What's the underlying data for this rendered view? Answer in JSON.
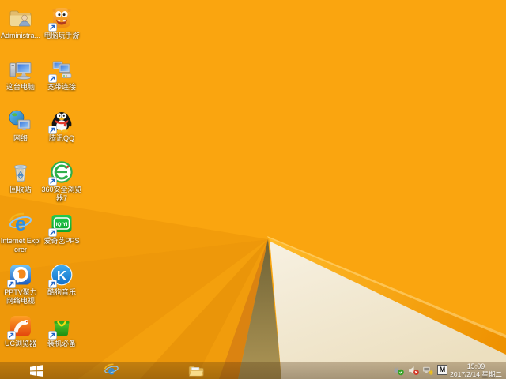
{
  "wallpaper": {
    "base_color": "#FAA50F",
    "cream_color": "#F2E8D2",
    "olive_color": "#9A874B",
    "fold_highlight_color": "#F5A000"
  },
  "desktop": {
    "icons": [
      {
        "label": "Administra...",
        "icon": "user-folder-icon",
        "shortcut": false
      },
      {
        "label": "这台电脑",
        "icon": "this-pc-icon",
        "shortcut": false
      },
      {
        "label": "网络",
        "icon": "network-icon",
        "shortcut": false
      },
      {
        "label": "回收站",
        "icon": "recycle-bin-icon",
        "shortcut": false
      },
      {
        "label": "Internet Explorer",
        "icon": "internet-explorer-icon",
        "shortcut": false
      },
      {
        "label": "PPTV聚力 网络电视",
        "icon": "pptv-icon",
        "shortcut": true
      },
      {
        "label": "UC浏览器",
        "icon": "uc-browser-icon",
        "shortcut": true
      },
      {
        "label": "电脑玩手游",
        "icon": "pc-mobile-game-icon",
        "shortcut": true
      },
      {
        "label": "宽带连接",
        "icon": "broadband-icon",
        "shortcut": true
      },
      {
        "label": "腾讯QQ",
        "icon": "qq-icon",
        "shortcut": true
      },
      {
        "label": "360安全浏览器7",
        "icon": "360-secure-browser-icon",
        "shortcut": true
      },
      {
        "label": "爱奇艺PPS",
        "icon": "iqiyi-pps-icon",
        "shortcut": true
      },
      {
        "label": "酷狗音乐",
        "icon": "kugou-music-icon",
        "shortcut": true
      },
      {
        "label": "装机必备",
        "icon": "software-bundle-bag-icon",
        "shortcut": true
      }
    ]
  },
  "taskbar": {
    "pinned_icons": [
      "windows-start-icon",
      "internet-explorer-icon",
      "file-explorer-icon"
    ],
    "tray": {
      "icons": [
        "safely-remove-hardware-icon",
        "volume-muted-icon",
        "network-warning-icon"
      ],
      "ime_indicator": "M",
      "time": "15:09",
      "date": "2017/2/14 星期二"
    }
  }
}
